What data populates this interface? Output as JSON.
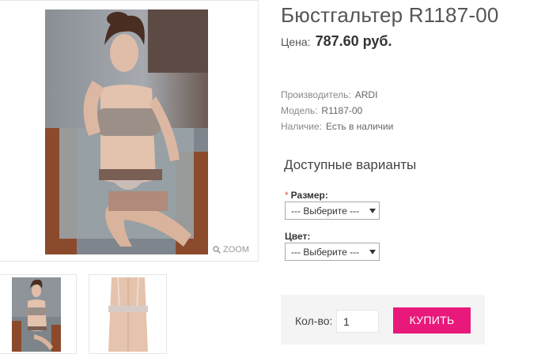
{
  "product": {
    "title": "Бюстгальтер R1187-00",
    "price_label": "Цена:",
    "price_value": "787.60 руб."
  },
  "gallery": {
    "zoom_label": "ZOOM"
  },
  "specs": [
    {
      "label": "Производитель:",
      "value": "ARDI"
    },
    {
      "label": "Модель:",
      "value": "R1187-00"
    },
    {
      "label": "Наличие:",
      "value": "Есть в наличии"
    }
  ],
  "options": {
    "heading": "Доступные варианты",
    "required_mark": "*",
    "size_label": "Размер:",
    "size_selected": "--- Выберите ---",
    "color_label": "Цвет:",
    "color_selected": "--- Выберите ---"
  },
  "cart": {
    "qty_label": "Кол-во:",
    "qty_value": "1",
    "buy_label": "КУПИТЬ"
  },
  "colors": {
    "accent": "#e8197b",
    "cart_bg": "#f4f4f4"
  }
}
